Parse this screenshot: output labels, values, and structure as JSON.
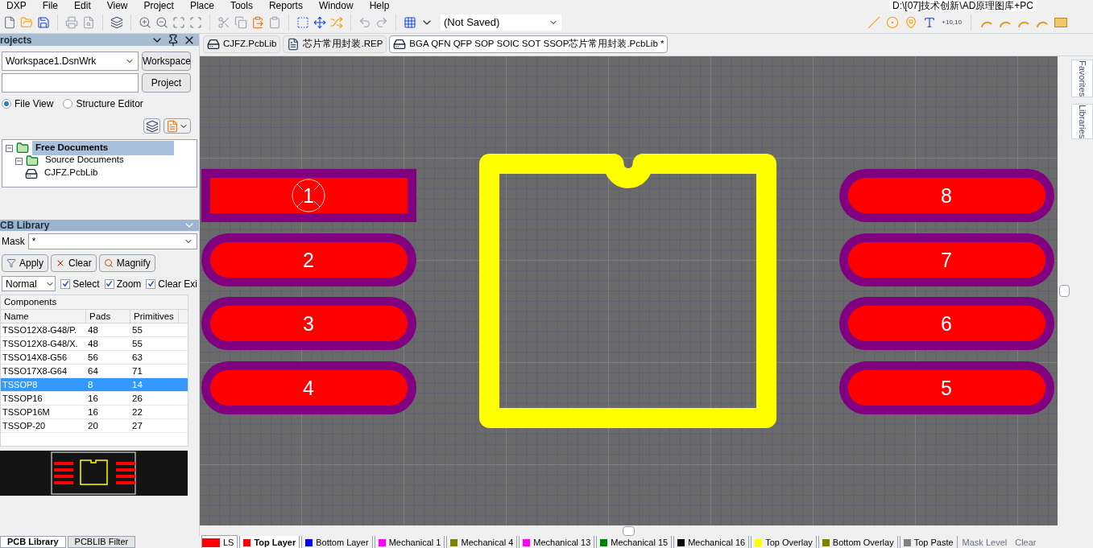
{
  "menu": [
    "DXP",
    "File",
    "Edit",
    "View",
    "Project",
    "Place",
    "Tools",
    "Reports",
    "Window",
    "Help"
  ],
  "path": "D:\\[07]技术创新\\AD原理图库+PC",
  "toolbar": {
    "current_view": "(Not Saved)",
    "coordinate_label": "+10,10"
  },
  "projects_panel": {
    "title": "rojects",
    "workspace": {
      "value": "Workspace1.DsnWrk",
      "button": "Workspace"
    },
    "project": {
      "button": "Project"
    },
    "views": [
      {
        "label": "File View",
        "selected": true
      },
      {
        "label": "Structure Editor",
        "selected": false
      }
    ],
    "tree": [
      {
        "label": "Free Documents",
        "expanded": true,
        "selected": true,
        "children": [
          {
            "label": "Source Documents",
            "expanded": true,
            "selected": false,
            "children": [
              {
                "label": "CJFZ.PcbLib",
                "selected": false
              }
            ]
          }
        ]
      }
    ]
  },
  "library_panel": {
    "title": "CB Library",
    "mask": {
      "label": "Mask",
      "value": "*"
    },
    "buttons": [
      "Apply",
      "Clear",
      "Magnify"
    ],
    "mode": "Normal",
    "options": [
      {
        "label": "Select",
        "checked": true
      },
      {
        "label": "Zoom",
        "checked": true
      },
      {
        "label": "Clear Exi",
        "checked": true
      }
    ],
    "components": {
      "title": "Components",
      "columns": [
        "Name",
        "Pads",
        "Primitives"
      ],
      "rows": [
        {
          "name": "TSSO12X8-G48/P.",
          "pads": "48",
          "primitives": "55",
          "selected": false
        },
        {
          "name": "TSSO12X8-G48/X.",
          "pads": "48",
          "primitives": "55",
          "selected": false
        },
        {
          "name": "TSSO14X8-G56",
          "pads": "56",
          "primitives": "63",
          "selected": false
        },
        {
          "name": "TSSO17X8-G64",
          "pads": "64",
          "primitives": "71",
          "selected": false
        },
        {
          "name": "TSSOP8",
          "pads": "8",
          "primitives": "14",
          "selected": true
        },
        {
          "name": "TSSOP16",
          "pads": "16",
          "primitives": "26",
          "selected": false
        },
        {
          "name": "TSSOP16M",
          "pads": "16",
          "primitives": "22",
          "selected": false
        },
        {
          "name": "TSSOP-20",
          "pads": "20",
          "primitives": "27",
          "selected": false
        }
      ]
    }
  },
  "doc_tabs": [
    {
      "label": "CJFZ.PcbLib",
      "kind": "pcb",
      "selected": false
    },
    {
      "label": "芯片常用封装.REP",
      "kind": "report",
      "selected": false
    },
    {
      "label": "BGA QFN QFP SOP SOIC SOT SSOP芯片常用封装.PcbLib *",
      "kind": "pcb",
      "selected": true
    }
  ],
  "left_pads": [
    {
      "number": "1",
      "kind": "rect"
    },
    {
      "number": "2",
      "kind": "rounded"
    },
    {
      "number": "3",
      "kind": "rounded"
    },
    {
      "number": "4",
      "kind": "rounded"
    }
  ],
  "right_pads": [
    {
      "number": "8",
      "kind": "rounded"
    },
    {
      "number": "7",
      "kind": "rounded"
    },
    {
      "number": "6",
      "kind": "rounded"
    },
    {
      "number": "5",
      "kind": "rounded"
    }
  ],
  "side_tabs": [
    "Favorites",
    "Libraries"
  ],
  "bottom_tabs": [
    {
      "label": "PCB Library",
      "selected": true
    },
    {
      "label": "PCBLIB Filter",
      "selected": false
    }
  ],
  "current_layer": {
    "label": "LS",
    "color": "#ff0000"
  },
  "layers": [
    {
      "label": "Top Layer",
      "color": "#ff0000",
      "selected": true
    },
    {
      "label": "Bottom Layer",
      "color": "#0000ff",
      "selected": false
    },
    {
      "label": "Mechanical 1",
      "color": "#ff00ff",
      "selected": false
    },
    {
      "label": "Mechanical 4",
      "color": "#808000",
      "selected": false
    },
    {
      "label": "Mechanical 13",
      "color": "#ff00ff",
      "selected": false
    },
    {
      "label": "Mechanical 15",
      "color": "#008000",
      "selected": false
    },
    {
      "label": "Mechanical 16",
      "color": "#000000",
      "selected": false
    },
    {
      "label": "Top Overlay",
      "color": "#ffff00",
      "selected": false
    },
    {
      "label": "Bottom Overlay",
      "color": "#808000",
      "selected": false
    },
    {
      "label": "Top Paste",
      "color": "#808080",
      "selected": false
    }
  ],
  "mask_level": "Mask Level",
  "clear": "Clear"
}
